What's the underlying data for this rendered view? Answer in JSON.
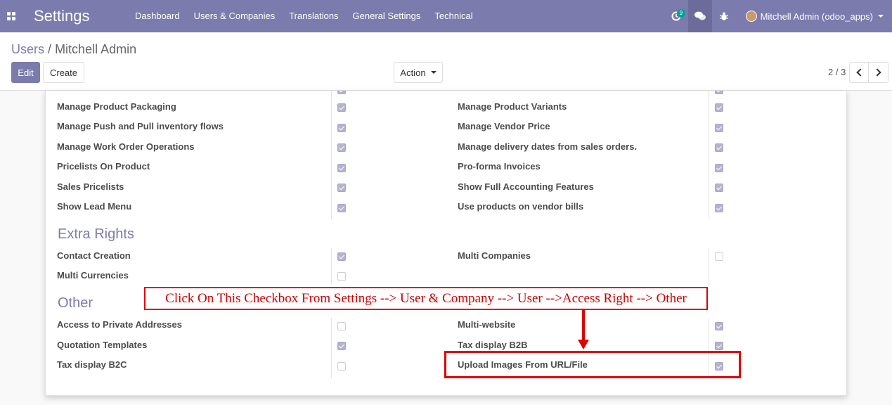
{
  "navbar": {
    "apps_icon": "apps-grid-icon",
    "brand": "Settings",
    "menu": [
      "Dashboard",
      "Users & Companies",
      "Translations",
      "General Settings",
      "Technical"
    ],
    "activity_badge": "9",
    "user": "Mitchell Admin (odoo_apps)"
  },
  "breadcrumb": {
    "parent": "Users",
    "separator": "/",
    "current": "Mitchell Admin"
  },
  "buttons": {
    "edit": "Edit",
    "create": "Create",
    "action": "Action"
  },
  "pager": "2 / 3",
  "rows_top": [
    {
      "left": "Manage Product Packaging",
      "left_checked": true,
      "right": "Manage Product Variants",
      "right_checked": true
    },
    {
      "left": "Manage Push and Pull inventory flows",
      "left_checked": true,
      "right": "Manage Vendor Price",
      "right_checked": true
    },
    {
      "left": "Manage Work Order Operations",
      "left_checked": true,
      "right": "Manage delivery dates from sales orders.",
      "right_checked": true
    },
    {
      "left": "Pricelists On Product",
      "left_checked": true,
      "right": "Pro-forma Invoices",
      "right_checked": true
    },
    {
      "left": "Sales Pricelists",
      "left_checked": true,
      "right": "Show Full Accounting Features",
      "right_checked": true
    },
    {
      "left": "Show Lead Menu",
      "left_checked": true,
      "right": "Use products on vendor bills",
      "right_checked": true
    }
  ],
  "extra_rights": {
    "title": "Extra Rights",
    "rows": [
      {
        "left": "Contact Creation",
        "left_checked": true,
        "right": "Multi Companies",
        "right_checked": false
      },
      {
        "left": "Multi Currencies",
        "left_checked": false,
        "right": "",
        "right_checked": null
      }
    ]
  },
  "other": {
    "title": "Other",
    "rows": [
      {
        "left": "Access to Private Addresses",
        "left_checked": false,
        "right": "Multi-website",
        "right_checked": true
      },
      {
        "left": "Quotation Templates",
        "left_checked": true,
        "right": "Tax display B2B",
        "right_checked": true
      },
      {
        "left": "Tax display B2C",
        "left_checked": false,
        "right": "Upload Images From URL/File",
        "right_checked": true
      }
    ]
  },
  "annotation": {
    "text": "Click On This Checkbox From Settings --> User & Company --> User -->Access Right --> Other",
    "color": "#e00000"
  },
  "colors": {
    "brand": "#7c7bad"
  }
}
